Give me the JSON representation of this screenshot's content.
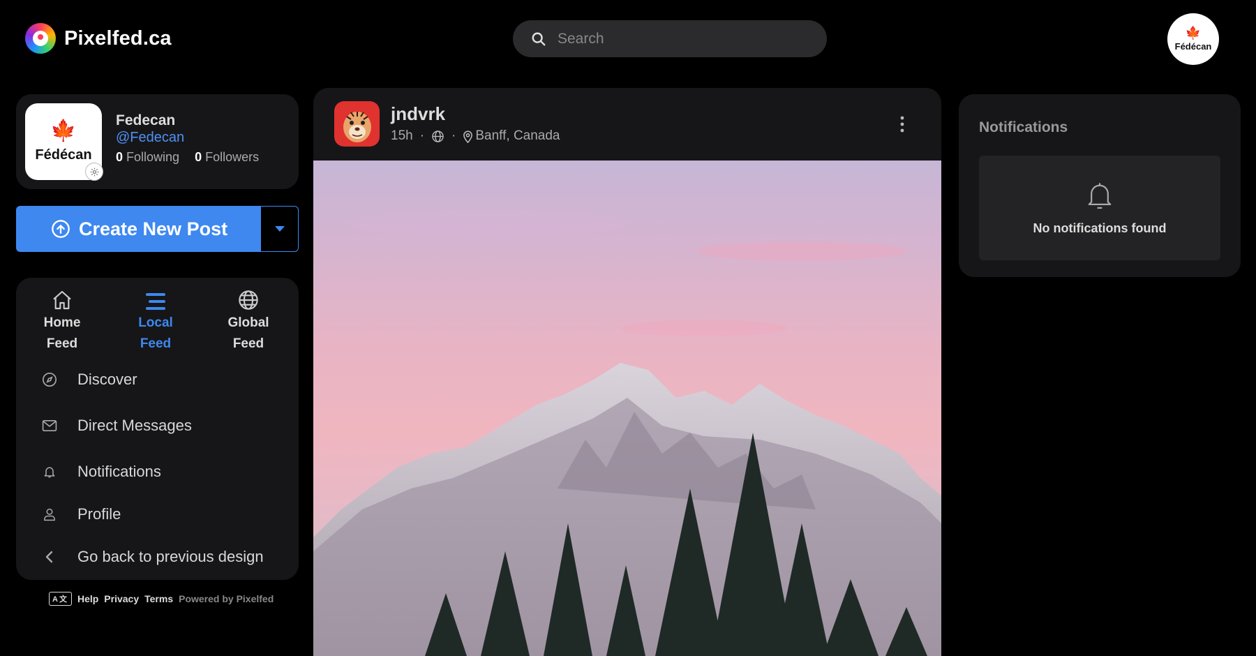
{
  "app": {
    "brand": "Pixelfed.ca",
    "search_placeholder": "Search",
    "account_avatar_text": "Fédécan"
  },
  "profile": {
    "avatar_text": "Fédécan",
    "name": "Fedecan",
    "handle": "@Fedecan",
    "following_count": "0",
    "following_label": "Following",
    "followers_count": "0",
    "followers_label": "Followers"
  },
  "create": {
    "label": "Create New Post"
  },
  "feeds": [
    {
      "line1": "Home",
      "line2": "Feed",
      "icon": "home-icon"
    },
    {
      "line1": "Local",
      "line2": "Feed",
      "icon": "bars-icon",
      "active": true
    },
    {
      "line1": "Global",
      "line2": "Feed",
      "icon": "globe-icon"
    }
  ],
  "nav": [
    {
      "label": "Discover",
      "icon": "compass-icon"
    },
    {
      "label": "Direct Messages",
      "icon": "envelope-icon"
    },
    {
      "label": "Notifications",
      "icon": "bell-icon"
    },
    {
      "label": "Profile",
      "icon": "user-icon"
    },
    {
      "label": "Go back to previous design",
      "icon": "chevron-left-icon"
    }
  ],
  "footer": {
    "lang": "A文",
    "help": "Help",
    "privacy": "Privacy",
    "terms": "Terms",
    "powered": "Powered by Pixelfed"
  },
  "post": {
    "username": "jndvrk",
    "time": "15h",
    "separator": "·",
    "location": "Banff, Canada"
  },
  "notifications": {
    "title": "Notifications",
    "empty": "No notifications found"
  },
  "colors": {
    "accent": "#3e88f0",
    "background": "#000000",
    "card": "#161618",
    "maple": "#d21f2a"
  }
}
